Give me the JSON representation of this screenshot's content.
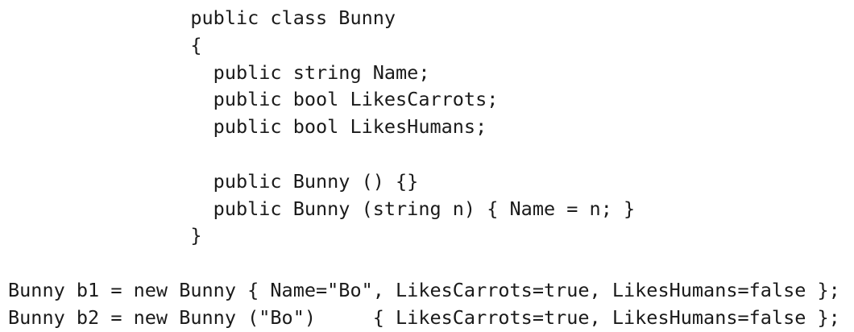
{
  "code_lines": [
    "                public class Bunny",
    "                {",
    "                  public string Name;",
    "                  public bool LikesCarrots;",
    "                  public bool LikesHumans;",
    "",
    "                  public Bunny () {}",
    "                  public Bunny (string n) { Name = n; }",
    "                }",
    "",
    "Bunny b1 = new Bunny { Name=\"Bo\", LikesCarrots=true, LikesHumans=false };",
    "Bunny b2 = new Bunny (\"Bo\")     { LikesCarrots=true, LikesHumans=false };"
  ]
}
